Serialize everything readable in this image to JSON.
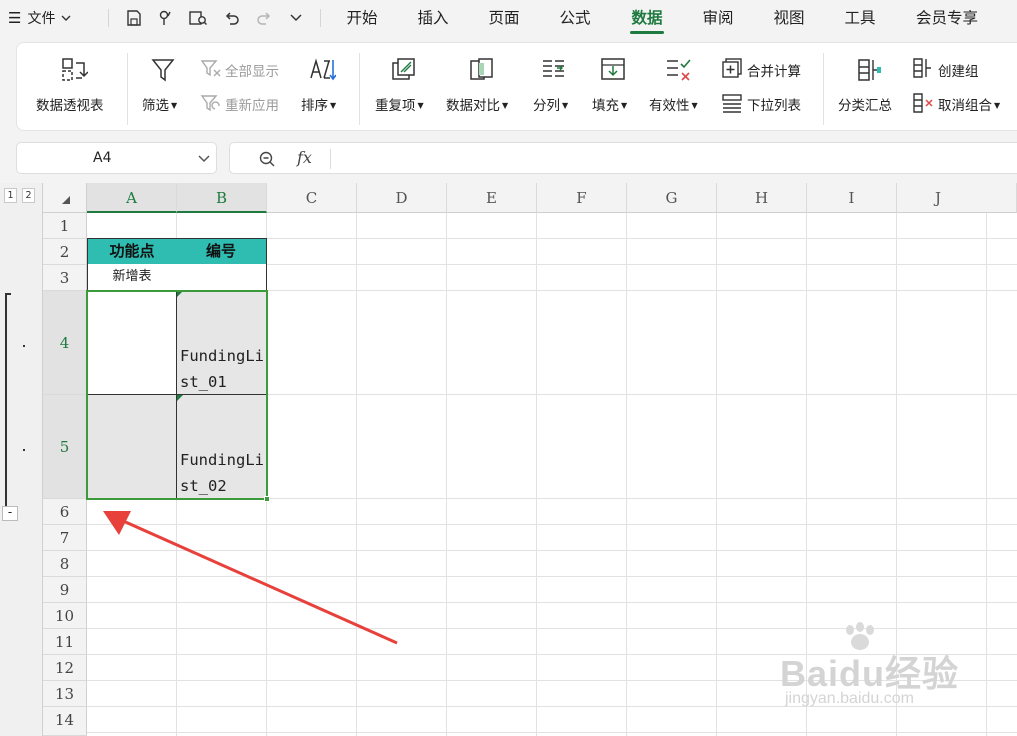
{
  "menubar": {
    "file_label": "文件",
    "tabs": [
      {
        "label": "开始",
        "active": false
      },
      {
        "label": "插入",
        "active": false
      },
      {
        "label": "页面",
        "active": false
      },
      {
        "label": "公式",
        "active": false
      },
      {
        "label": "数据",
        "active": true
      },
      {
        "label": "审阅",
        "active": false
      },
      {
        "label": "视图",
        "active": false
      },
      {
        "label": "工具",
        "active": false
      },
      {
        "label": "会员专享",
        "active": false
      }
    ],
    "accent_color": "#1f7a3f"
  },
  "ribbon": {
    "pivot": "数据透视表",
    "filter": "筛选",
    "show_all": "全部显示",
    "reapply": "重新应用",
    "sort": "排序",
    "duplicates": "重复项",
    "compare": "数据对比",
    "split": "分列",
    "fill": "填充",
    "validity": "有效性",
    "consolidate": "合并计算",
    "dropdown_list": "下拉列表",
    "subtotal": "分类汇总",
    "create_group": "创建组",
    "ungroup": "取消组合"
  },
  "namebox": {
    "value": "A4"
  },
  "formula": {
    "fx_label": "fx",
    "value": ""
  },
  "outline": {
    "levels": [
      "1",
      "2"
    ],
    "collapse_symbol": "-"
  },
  "columns": [
    "A",
    "B",
    "C",
    "D",
    "E",
    "F",
    "G",
    "H",
    "I",
    "J"
  ],
  "rows": [
    "1",
    "2",
    "3",
    "4",
    "5",
    "6",
    "7",
    "8",
    "9",
    "10",
    "11",
    "12",
    "13",
    "14"
  ],
  "cells": {
    "A2": "功能点",
    "B2": "编号",
    "A3": "新增表",
    "B3": "",
    "A4": "",
    "B4": "FundingList_01",
    "A5": "",
    "B5": "FundingList_02"
  },
  "colors": {
    "header_fill": "#2ebdb0",
    "selection": "#1f7a3f",
    "annotation_arrow": "#e8413c"
  },
  "watermark": {
    "text": "Baidu经验",
    "url": "jingyan.baidu.com"
  }
}
